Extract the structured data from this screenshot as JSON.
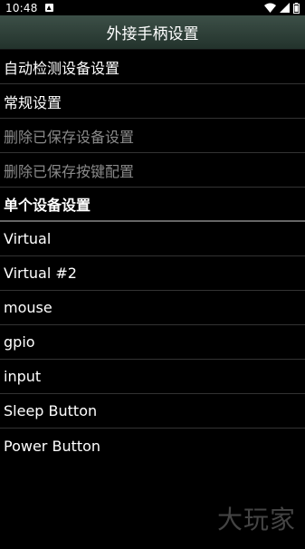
{
  "status": {
    "time": "10:48"
  },
  "title": "外接手柄设置",
  "items": [
    {
      "label": "自动检测设备设置"
    },
    {
      "label": "常规设置"
    },
    {
      "label": "删除已保存设备设置"
    },
    {
      "label": "删除已保存按键配置"
    },
    {
      "label": "单个设备设置"
    },
    {
      "label": "Virtual"
    },
    {
      "label": "Virtual #2"
    },
    {
      "label": "mouse"
    },
    {
      "label": "gpio"
    },
    {
      "label": "input"
    },
    {
      "label": "Sleep Button"
    },
    {
      "label": "Power Button"
    }
  ],
  "watermark": "大玩家"
}
